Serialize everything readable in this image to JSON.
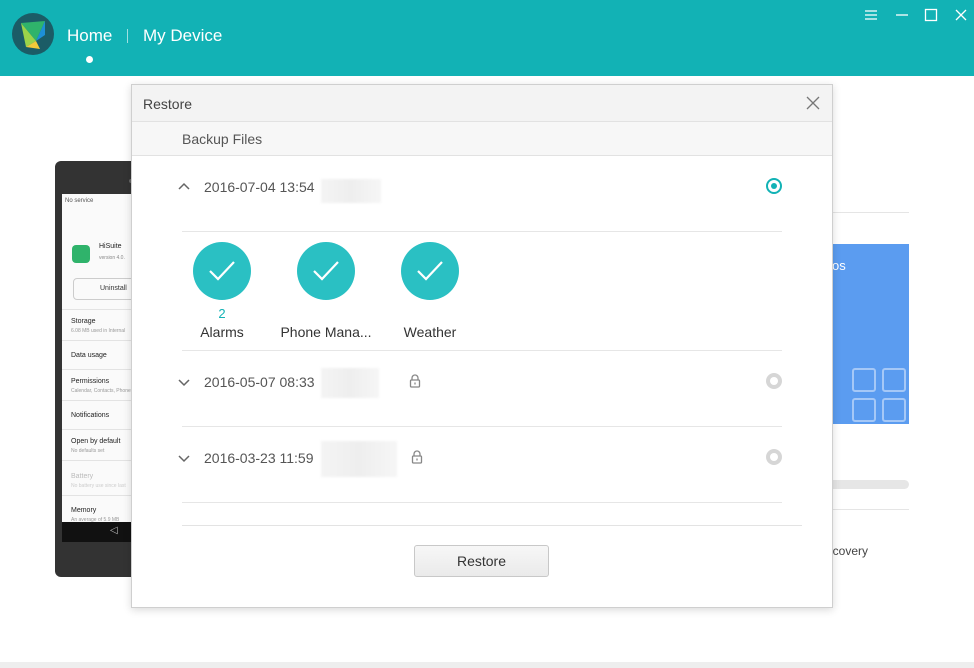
{
  "header": {
    "nav": [
      {
        "label": "Home",
        "active": true
      },
      {
        "label": "My Device",
        "active": false
      }
    ],
    "window_controls": [
      "menu-icon",
      "minimize-icon",
      "maximize-icon",
      "close-icon"
    ],
    "brand_color": "#12b2b5"
  },
  "background": {
    "phone": {
      "status": "No service",
      "app_name": "HiSuite",
      "app_version": "version 4.0.",
      "uninstall_label": "Uninstall",
      "rows": [
        {
          "label": "Storage",
          "sub": "6.08 MB used in Internal"
        },
        {
          "label": "Data usage",
          "sub": ""
        },
        {
          "label": "Permissions",
          "sub": "Calendar, Contacts, Phone"
        },
        {
          "label": "Notifications",
          "sub": ""
        },
        {
          "label": "Open by default",
          "sub": "No defaults set"
        },
        {
          "label": "Battery",
          "sub": "No battery use since last"
        },
        {
          "label": "Memory",
          "sub": "An average of 5.9 MB"
        }
      ]
    },
    "right_panel": {
      "blue_tile_text": "os",
      "recovery_text": "ecovery",
      "tile_color": "#5b9cf0"
    }
  },
  "dialog": {
    "title": "Restore",
    "subheader": "Backup Files",
    "backups": [
      {
        "date": "2016-07-04 13:54",
        "expanded": true,
        "selected": true,
        "locked": false,
        "items": [
          {
            "label": "Alarms",
            "count": "2",
            "icon": "check-icon"
          },
          {
            "label": "Phone Mana...",
            "count": "",
            "icon": "check-icon"
          },
          {
            "label": "Weather",
            "count": "",
            "icon": "check-icon"
          }
        ]
      },
      {
        "date": "2016-05-07 08:33",
        "expanded": false,
        "selected": false,
        "locked": true
      },
      {
        "date": "2016-03-23 11:59",
        "expanded": false,
        "selected": false,
        "locked": true
      }
    ],
    "restore_button": "Restore",
    "accent_color": "#2ac0c3"
  }
}
